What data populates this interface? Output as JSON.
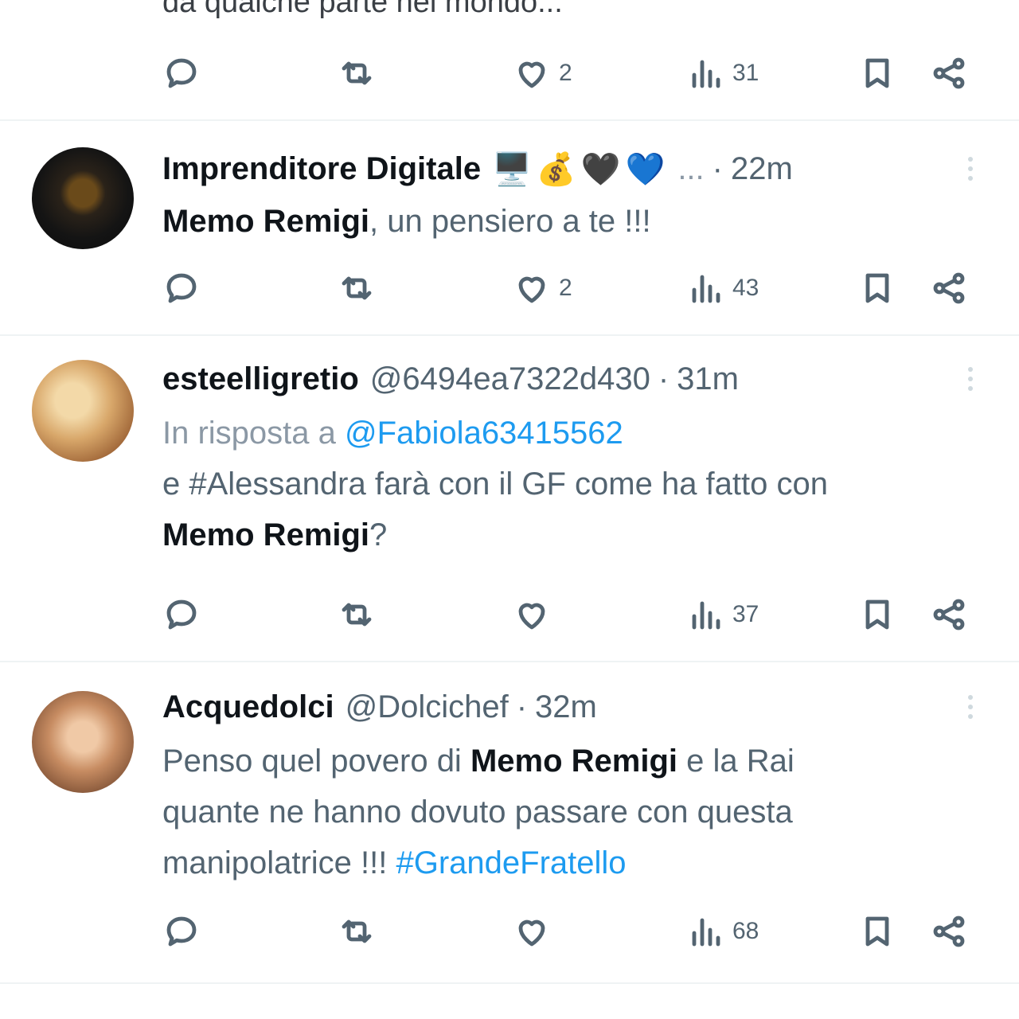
{
  "feed": {
    "partial_text": "da qualche parte nel mondo...",
    "tweets": [
      {
        "actions": {
          "replies": "",
          "retweets": "",
          "likes": "2",
          "views": "31"
        }
      },
      {
        "name": "Imprenditore Digitale",
        "emojis": [
          "🖥️",
          "💰",
          "🖤",
          "💙"
        ],
        "ellipsis": "...",
        "time": "22m",
        "mention_bold": "Memo Remigi",
        "text": ", un pensiero a te !!!",
        "actions": {
          "replies": "",
          "retweets": "",
          "likes": "2",
          "views": "43"
        }
      },
      {
        "name": "esteelligretio",
        "handle": "@6494ea7322d430",
        "time": "31m",
        "reply_prefix": "In risposta a",
        "reply_to": "@Fabiola63415562",
        "line2": "e #Alessandra farà con il GF come ha fatto con",
        "mention_bold": "Memo Remigi",
        "line3_suffix": "?",
        "actions": {
          "replies": "",
          "retweets": "",
          "likes": "",
          "views": "37"
        }
      },
      {
        "name": "Acquedolci",
        "handle": "@Dolcichef",
        "time": "32m",
        "text_a": "Penso quel povero di",
        "mention_bold": "Memo Remigi",
        "text_b": "e la Rai",
        "text_c": "quante ne hanno dovuto passare con questa",
        "text_d": "manipolatrice !!!",
        "hashtag": "#GrandeFratello",
        "actions": {
          "replies": "",
          "retweets": "",
          "likes": "",
          "views": "68"
        }
      }
    ]
  }
}
